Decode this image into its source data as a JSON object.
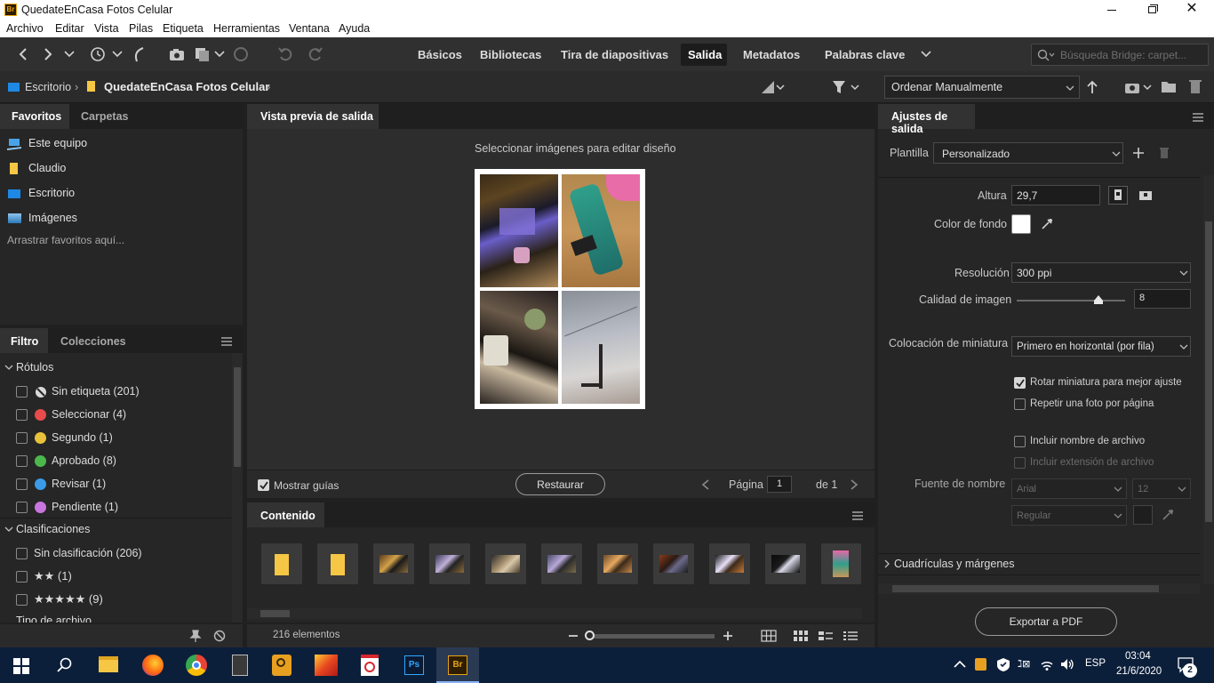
{
  "window": {
    "title": "QuedateEnCasa Fotos Celular",
    "app_badge": "Br"
  },
  "menu": [
    "Archivo",
    "Editar",
    "Vista",
    "Pilas",
    "Etiqueta",
    "Herramientas",
    "Ventana",
    "Ayuda"
  ],
  "workspaces": [
    "Básicos",
    "Bibliotecas",
    "Tira de diapositivas",
    "Salida",
    "Metadatos",
    "Palabras clave"
  ],
  "active_workspace": "Salida",
  "search": {
    "placeholder": "Búsqueda Bridge: carpet..."
  },
  "breadcrumb": {
    "root": "Escritorio",
    "folder": "QuedateEnCasa Fotos Celular"
  },
  "sort": {
    "value": "Ordenar Manualmente"
  },
  "left_tabs": {
    "favorites": "Favoritos",
    "folders": "Carpetas"
  },
  "favorites": [
    {
      "label": "Este equipo",
      "icon": "computer-icon"
    },
    {
      "label": "Claudio",
      "icon": "folder-icon"
    },
    {
      "label": "Escritorio",
      "icon": "desktop-icon"
    },
    {
      "label": "Imágenes",
      "icon": "pictures-icon"
    }
  ],
  "favorites_hint": "Arrastrar favoritos aquí...",
  "filter_tabs": {
    "filter": "Filtro",
    "collections": "Colecciones"
  },
  "filter": {
    "labels_header": "Rótulos",
    "labels": [
      {
        "label": "Sin etiqueta (201)",
        "color": "#d9d9d9"
      },
      {
        "label": "Seleccionar (4)",
        "color": "#e84b4b"
      },
      {
        "label": "Segundo (1)",
        "color": "#e8c23a"
      },
      {
        "label": "Aprobado (8)",
        "color": "#4cb84c"
      },
      {
        "label": "Revisar (1)",
        "color": "#3b9be8"
      },
      {
        "label": "Pendiente (1)",
        "color": "#c875e0"
      }
    ],
    "ratings_header": "Clasificaciones",
    "ratings": [
      "Sin clasificación (206)",
      "★★ (1)",
      "★★★★★ (9)"
    ],
    "filetype_header": "Tipo de archivo"
  },
  "preview": {
    "tab": "Vista previa de salida",
    "instruction": "Seleccionar imágenes para editar diseño",
    "show_guides": "Mostrar guías",
    "restore": "Restaurar",
    "page_label": "Página",
    "page_value": "1",
    "page_of": "de 1"
  },
  "content": {
    "tab": "Contenido",
    "count": "216 elementos"
  },
  "settings": {
    "tab": "Ajustes de salida",
    "template_label": "Plantilla",
    "template_value": "Personalizado",
    "height_label": "Altura",
    "height_value": "29,7",
    "bg_label": "Color de fondo",
    "bg_color": "#ffffff",
    "resolution_label": "Resolución",
    "resolution_value": "300 ppi",
    "quality_label": "Calidad de imagen",
    "quality_value": "8",
    "quality_fraction": 0.75,
    "placement_label": "Colocación de miniatura",
    "placement_value": "Primero en horizontal (por fila)",
    "rotate_label": "Rotar miniatura para mejor ajuste",
    "repeat_label": "Repetir una foto por página",
    "include_name_label": "Incluir nombre de archivo",
    "include_ext_label": "Incluir extensión de archivo",
    "font_label": "Fuente de nombre",
    "font_family": "Arial",
    "font_size": "12",
    "font_style": "Regular",
    "grid_section": "Cuadrículas y márgenes",
    "export": "Exportar a PDF"
  },
  "taskbar": {
    "lang": "ESP",
    "time": "03:04",
    "date": "21/6/2020",
    "notif": "2"
  }
}
